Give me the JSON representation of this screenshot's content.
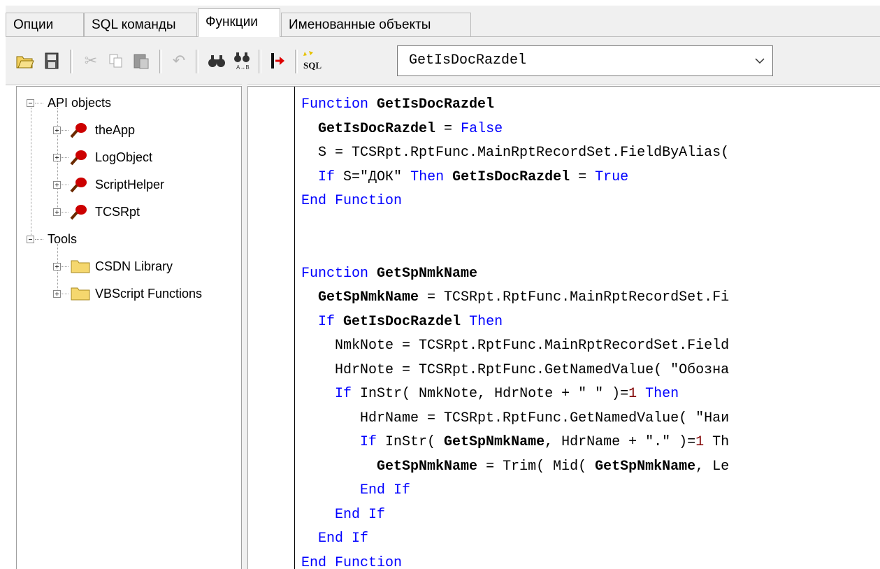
{
  "tabs": [
    {
      "label": "Опции",
      "active": false
    },
    {
      "label": "SQL команды",
      "active": false
    },
    {
      "label": "Функции",
      "active": true
    },
    {
      "label": "Именованные объекты",
      "active": false
    }
  ],
  "toolbar": {
    "function_select": {
      "value": "GetIsDocRazdel"
    },
    "icons": [
      "open-folder-icon",
      "save-icon",
      "cut-icon",
      "copy-icon",
      "paste-icon",
      "undo-icon",
      "find-icon",
      "replace-icon",
      "goto-line-icon",
      "sql-icon"
    ]
  },
  "tree": {
    "api_objects": {
      "label": "API objects",
      "items": [
        "theApp",
        "LogObject",
        "ScriptHelper",
        "TCSRpt"
      ]
    },
    "tools": {
      "label": "Tools",
      "items": [
        "CSDN Library",
        "VBScript Functions"
      ]
    }
  },
  "code": {
    "lines": [
      "Function GetIsDocRazdel",
      "  GetIsDocRazdel = False",
      "  S = TCSRpt.RptFunc.MainRptRecordSet.FieldByAlias(",
      "  If S=\"ДОК\" Then GetIsDocRazdel = True",
      "End Function",
      "",
      "",
      "Function GetSpNmkName",
      "  GetSpNmkName = TCSRpt.RptFunc.MainRptRecordSet.Fi",
      "  If GetIsDocRazdel Then",
      "    NmkNote = TCSRpt.RptFunc.MainRptRecordSet.Field",
      "    HdrNote = TCSRpt.RptFunc.GetNamedValue( \"Обозна",
      "    If InStr( NmkNote, HdrNote + \" \" )=1 Then",
      "       HdrName = TCSRpt.RptFunc.GetNamedValue( \"Наи",
      "       If InStr( GetSpNmkName, HdrName + \".\" )=1 Th",
      "         GetSpNmkName = Trim( Mid( GetSpNmkName, Le",
      "       End If",
      "    End If",
      "  End If",
      "End Function"
    ]
  },
  "colors": {
    "keyword": "#0000ff",
    "number": "#800000",
    "panel_bg": "#f0f0f0",
    "object_icon": "#cc0000",
    "folder_icon": "#f5d76e"
  }
}
